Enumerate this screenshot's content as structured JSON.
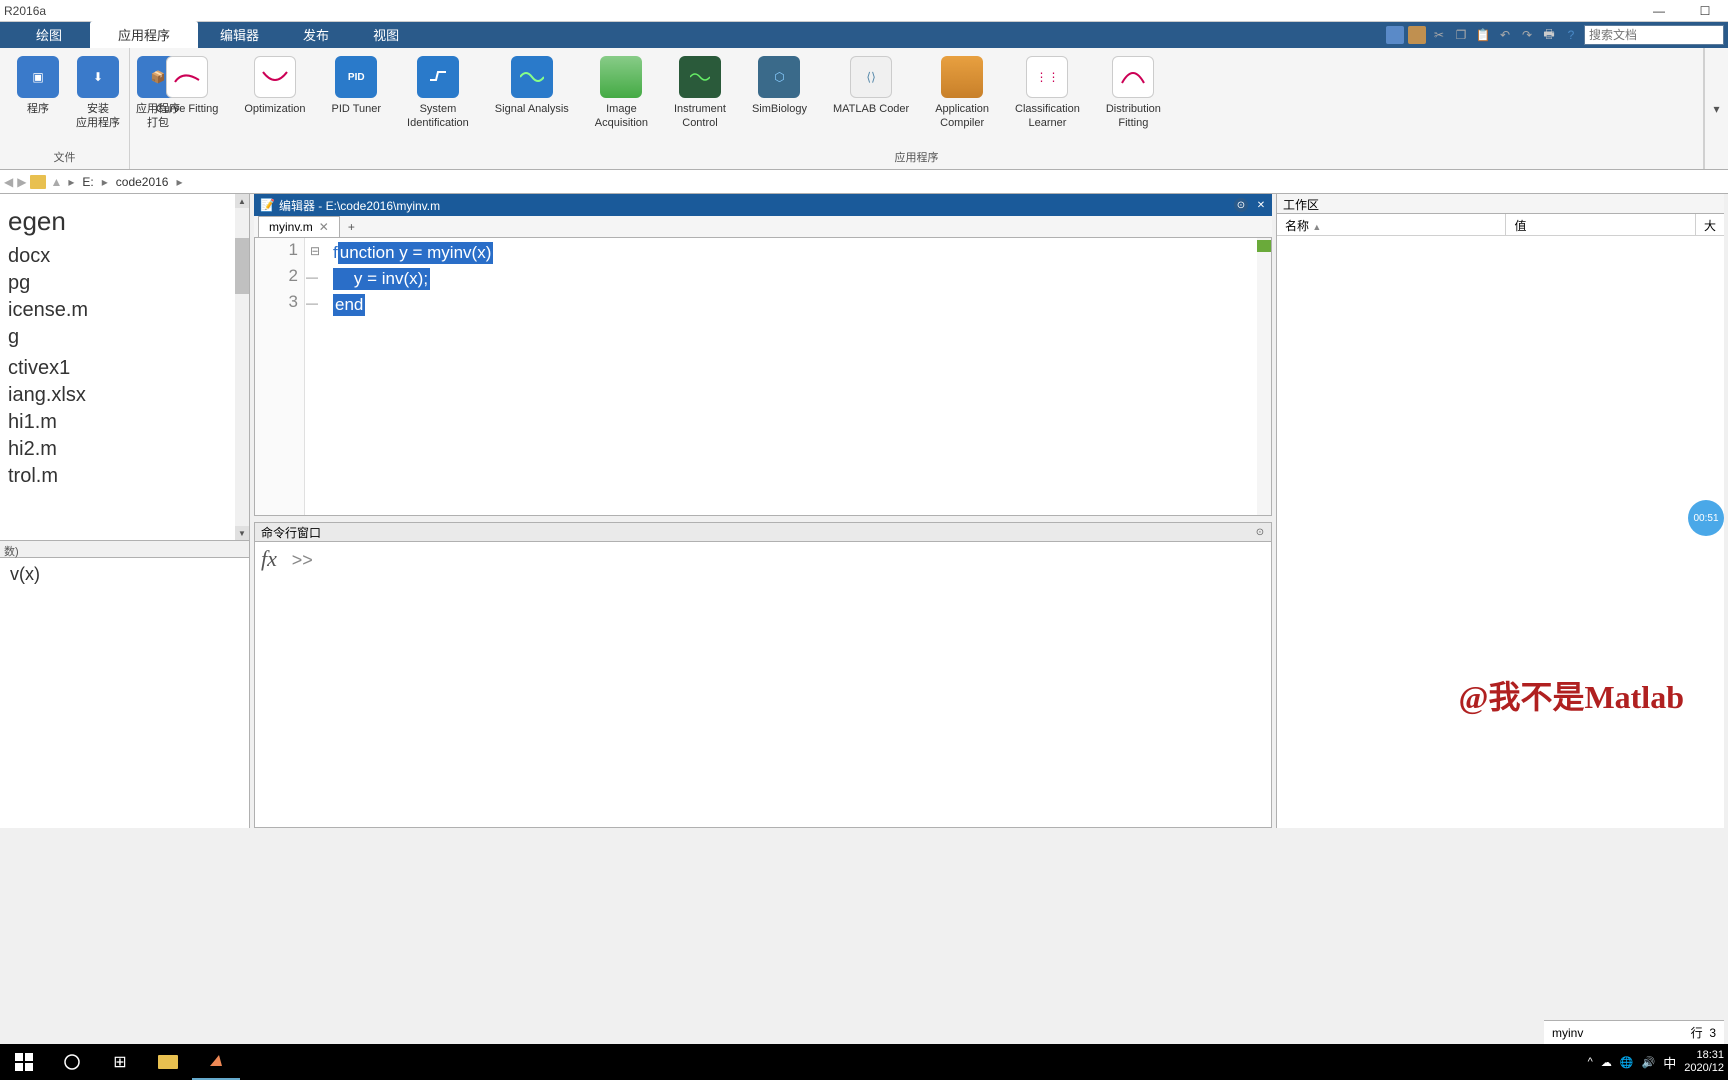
{
  "window": {
    "title": "R2016a"
  },
  "tabs": {
    "plot": "绘图",
    "apps": "应用程序",
    "editor": "编辑器",
    "publish": "发布",
    "view": "视图"
  },
  "search": {
    "placeholder": "搜索文档"
  },
  "ribbon": {
    "file_group_label": "文件",
    "app_group_label": "应用程序",
    "btn_install": "安装\n应用程序",
    "btn_package": "应用程序\n打包",
    "btn_prog": "程序",
    "curve_fit": "Curve Fitting",
    "optim": "Optimization",
    "pid": "PID Tuner",
    "sysid": "System\nIdentification",
    "signal": "Signal Analysis",
    "imga": "Image\nAcquisition",
    "instr": "Instrument\nControl",
    "simb": "SimBiology",
    "coder": "MATLAB Coder",
    "appc": "Application\nCompiler",
    "clsl": "Classification\nLearner",
    "dist": "Distribution\nFitting"
  },
  "path": {
    "drive": "E:",
    "folder": "code2016"
  },
  "files": {
    "heading": "egen",
    "items": [
      "docx",
      "pg",
      "icense.m",
      "g",
      "",
      "ctivex1",
      "iang.xlsx",
      "hi1.m",
      "hi2.m",
      "trol.m"
    ],
    "section1": "数)",
    "section2": "v(x)"
  },
  "editor": {
    "title_prefix": "编辑器 - ",
    "title_path": "E:\\code2016\\myinv.m",
    "tab_name": "myinv.m",
    "line1_a": "f",
    "line1_b": "unction y = myinv(x)",
    "line2": "    y = inv(x);",
    "line3": "end"
  },
  "cmd": {
    "title": "命令行窗口",
    "prompt": ">>"
  },
  "workspace": {
    "title": "工作区",
    "col_name": "名称",
    "col_value": "值",
    "col_size": "大"
  },
  "watermark": "@我不是Matlab",
  "status": {
    "fn": "myinv",
    "line_lbl": "行",
    "line_no": "3"
  },
  "timer": "00:51",
  "systray": {
    "ime": "中",
    "time": "18:31",
    "date": "2020/12"
  }
}
